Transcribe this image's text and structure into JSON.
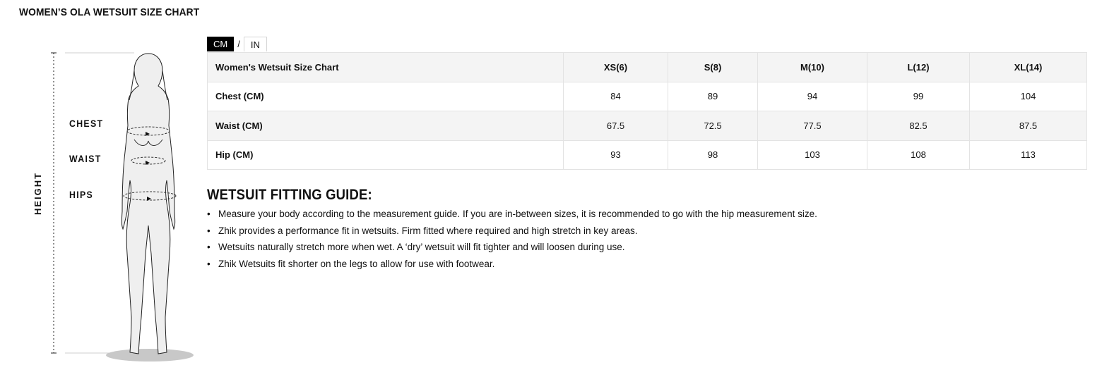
{
  "page": {
    "title": "WOMEN’S OLA WETSUIT SIZE CHART"
  },
  "figure": {
    "chest_label": "CHEST",
    "waist_label": "WAIST",
    "hips_label": "HIPS",
    "height_label": "HEIGHT"
  },
  "unit_toggle": {
    "cm": "CM",
    "separator": "/",
    "in": "IN",
    "selected": "CM"
  },
  "size_table": {
    "header": [
      "Women's Wetsuit Size Chart",
      "XS(6)",
      "S(8)",
      "M(10)",
      "L(12)",
      "XL(14)"
    ],
    "rows": [
      {
        "label": "Chest (CM)",
        "values": [
          "84",
          "89",
          "94",
          "99",
          "104"
        ]
      },
      {
        "label": "Waist (CM)",
        "values": [
          "67.5",
          "72.5",
          "77.5",
          "82.5",
          "87.5"
        ]
      },
      {
        "label": "Hip (CM)",
        "values": [
          "93",
          "98",
          "103",
          "108",
          "113"
        ]
      }
    ]
  },
  "guide": {
    "title": "WETSUIT FITTING GUIDE:",
    "items": [
      "Measure your body according to the measurement guide. If you are in-between sizes, it is recommended to go with the hip measurement size.",
      "Zhik provides a performance fit in wetsuits. Firm fitted where required and high stretch in key areas.",
      "Wetsuits naturally stretch more when wet. A ‘dry’ wetsuit will fit tighter and will loosen during use.",
      "Zhik Wetsuits fit shorter on the legs to allow for use with footwear."
    ],
    "bullet": "•"
  },
  "colors": {
    "active_toggle_bg": "#000000",
    "table_stripe": "#f4f4f4",
    "border": "#e3e3e3",
    "figure_fill": "#efefef"
  }
}
